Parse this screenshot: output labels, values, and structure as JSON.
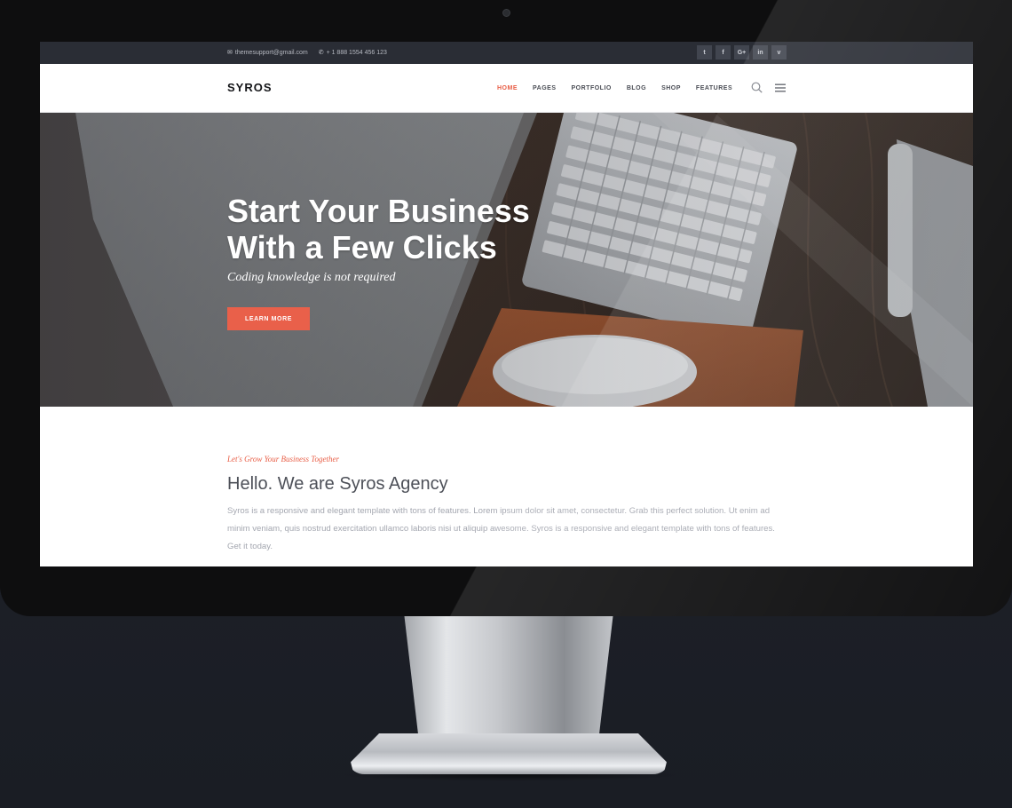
{
  "topbar": {
    "email": "themesupport@gmail.com",
    "phone": "+ 1 888 1554 456 123",
    "social": [
      {
        "icon": "twitter-icon",
        "glyph": "t"
      },
      {
        "icon": "facebook-icon",
        "glyph": "f"
      },
      {
        "icon": "google-plus-icon",
        "glyph": "G+"
      },
      {
        "icon": "linkedin-icon",
        "glyph": "in"
      },
      {
        "icon": "vimeo-icon",
        "glyph": "v"
      }
    ]
  },
  "navbar": {
    "logo": "SYROS",
    "items": [
      {
        "label": "HOME",
        "active": true
      },
      {
        "label": "PAGES",
        "active": false
      },
      {
        "label": "PORTFOLIO",
        "active": false
      },
      {
        "label": "BLOG",
        "active": false
      },
      {
        "label": "SHOP",
        "active": false
      },
      {
        "label": "FEATURES",
        "active": false
      }
    ]
  },
  "hero": {
    "title_line1": "Start Your Business",
    "title_line2": "With a Few Clicks",
    "subtitle": "Coding knowledge is not required",
    "button": "LEARN MORE"
  },
  "intro": {
    "eyebrow": "Let's Grow Your Business Together",
    "heading": "Hello. We are Syros Agency",
    "body": "Syros is a responsive and elegant template with tons of features. Lorem ipsum dolor sit amet, consectetur. Grab this perfect solution. Ut enim ad minim veniam, quis nostrud exercitation ullamco laboris nisi ut aliquip awesome. Syros is a responsive and elegant template with tons of features. Get it today."
  },
  "colors": {
    "accent": "#e85d45",
    "topbar": "#2a2d35",
    "button": "#e9604a"
  }
}
